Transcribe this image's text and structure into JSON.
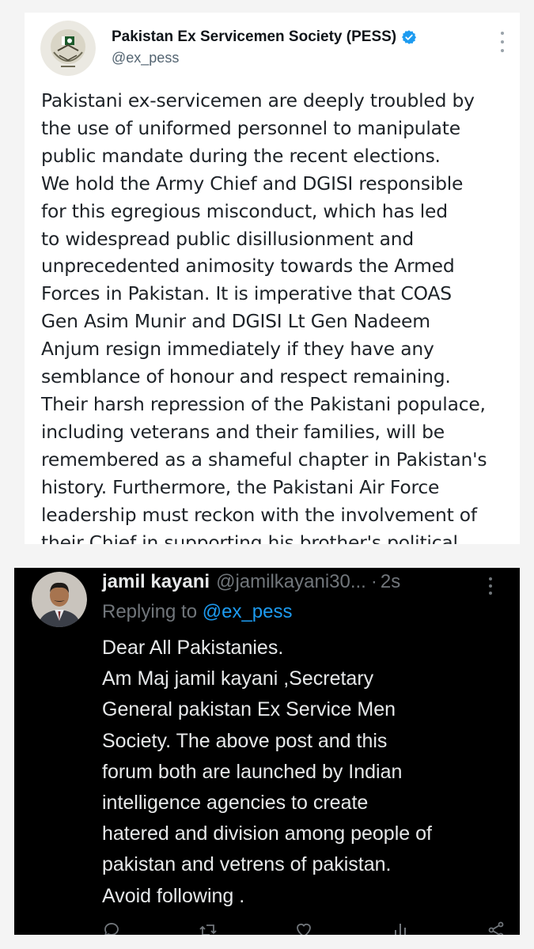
{
  "top_post": {
    "author_name": "Pakistan Ex Servicemen Society (PESS)",
    "handle": "@ex_pess",
    "verified": true,
    "body": "Pakistani ex-servicemen are deeply troubled by\nthe use of uniformed personnel to manipulate\npublic mandate during the recent elections.\nWe hold the Army Chief and DGISI responsible\nfor this egregious misconduct, which has led\nto widespread public disillusionment and\nunprecedented animosity towards the Armed\nForces in Pakistan. It is imperative that COAS\nGen Asim Munir and DGISI Lt Gen Nadeem\nAnjum resign immediately if they have any\nsemblance of honour and respect remaining.\nTheir harsh repression of the Pakistani populace,\nincluding veterans and their families, will be\nremembered as a shameful chapter in Pakistan's\nhistory. Furthermore, the Pakistani Air Force\nleadership must reckon with the involvement of\ntheir Chief in supporting his brother's political",
    "avatar_icon": "pess-emblem-avatar",
    "more_icon": "more-vertical-icon"
  },
  "reply_post": {
    "author_name": "jamil kayani",
    "handle": "@jamilkayani30...",
    "separator": "·",
    "timestamp": "2s",
    "replying_label": "Replying to",
    "replying_to": "@ex_pess",
    "body": "Dear All Pakistanies.\nAm Maj jamil kayani ,Secretary\nGeneral pakistan Ex Service Men\nSociety.  The above post and this\nforum both are launched by Indian\nintelligence agencies to create\nhatered and division among people of\npakistan and vetrens of pakistan.\nAvoid following  .",
    "avatar_icon": "user-photo-avatar",
    "action_icons": [
      "reply-icon",
      "retweet-icon",
      "like-icon",
      "views-icon",
      "share-icon"
    ]
  },
  "colors": {
    "verified_blue": "#1d9bf0",
    "link_blue": "#1d9bf0",
    "dark_bg": "#000000",
    "muted_text": "#71767b"
  }
}
